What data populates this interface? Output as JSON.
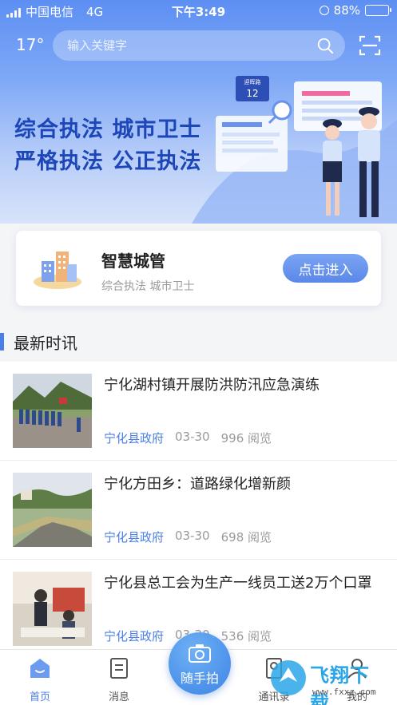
{
  "status_bar": {
    "carrier": "中国电信",
    "network": "4G",
    "time": "下午3:49",
    "battery": "88%",
    "battery_level": 0.88
  },
  "header": {
    "temperature": "17°",
    "search_placeholder": "输入关键字"
  },
  "banner": {
    "slogan_line1": "综合执法 城市卫士",
    "slogan_line2": "严格执法 公正执法",
    "sign_text": "迎晖路",
    "sign_number": "12"
  },
  "feature_card": {
    "title": "智慧城管",
    "subtitle": "综合执法 城市卫士",
    "button_label": "点击进入"
  },
  "news_section": {
    "heading": "最新时讯",
    "items": [
      {
        "title": "宁化湖村镇开展防洪防汛应急演练",
        "source": "宁化县政府",
        "date": "03-30",
        "views": "996 阅览"
      },
      {
        "title": "宁化方田乡：道路绿化增新颜",
        "source": "宁化县政府",
        "date": "03-30",
        "views": "698 阅览"
      },
      {
        "title": "宁化县总工会为生产一线员工送2万个口罩",
        "source": "宁化县政府",
        "date": "03-30",
        "views": "536 阅览"
      }
    ]
  },
  "bottom_nav": {
    "home": "首页",
    "messages": "消息",
    "camera": "随手拍",
    "tab4": "通讯录",
    "tab5": "我的"
  },
  "watermark": {
    "text": "飞翔下载",
    "url": "www.fxxz.com"
  },
  "colors": {
    "accent": "#4a7ee8",
    "banner_top": "#5d8ff3",
    "slogan": "#1d46b8"
  }
}
